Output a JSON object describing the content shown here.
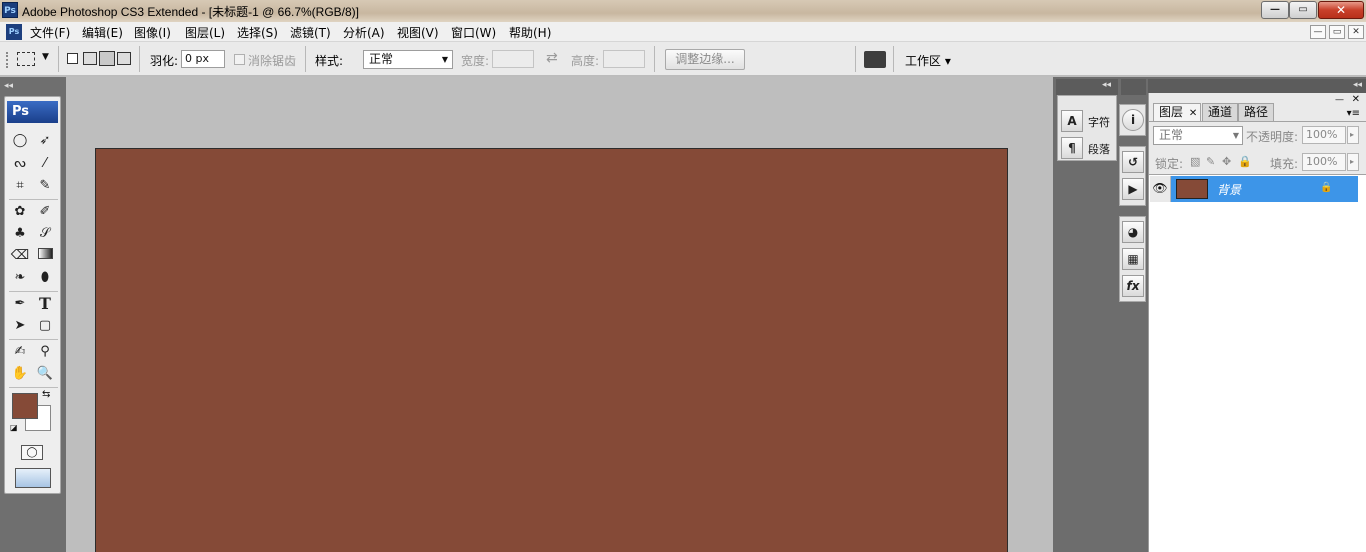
{
  "window": {
    "title": "Adobe Photoshop CS3 Extended - [未标题-1 @ 66.7%(RGB/8)]",
    "app_icon": "Ps",
    "controls": {
      "minimize": "—",
      "maximize": "▭",
      "close": "✕"
    }
  },
  "menu": {
    "items": [
      "文件(F)",
      "编辑(E)",
      "图像(I)",
      "图层(L)",
      "选择(S)",
      "滤镜(T)",
      "分析(A)",
      "视图(V)",
      "窗口(W)",
      "帮助(H)"
    ],
    "doc_controls": {
      "minimize": "—",
      "restore": "▭",
      "close": "✕"
    }
  },
  "options": {
    "feather_label": "羽化:",
    "feather_value": "0 px",
    "antialias_label": "消除锯齿",
    "style_label": "样式:",
    "style_value": "正常",
    "width_label": "宽度:",
    "height_label": "高度:",
    "refine_edge": "调整边缘...",
    "workspace": "工作区 ▾"
  },
  "toolbox": {
    "logo": "Ps",
    "foreground_color": "#854a37",
    "background_color": "#ffffff"
  },
  "document": {
    "fill_color": "#854a37"
  },
  "char_panel": {
    "character": "字符",
    "paragraph": "段落"
  },
  "layers_panel": {
    "tabs": [
      "图层",
      "通道",
      "路径"
    ],
    "blend_mode": "正常",
    "opacity_label": "不透明度:",
    "opacity_value": "100%",
    "lock_label": "锁定:",
    "fill_label": "填充:",
    "fill_value": "100%",
    "layers": [
      {
        "name": "背景",
        "visible": true,
        "locked": true,
        "selected": true,
        "thumb_color": "#854a37"
      }
    ]
  }
}
